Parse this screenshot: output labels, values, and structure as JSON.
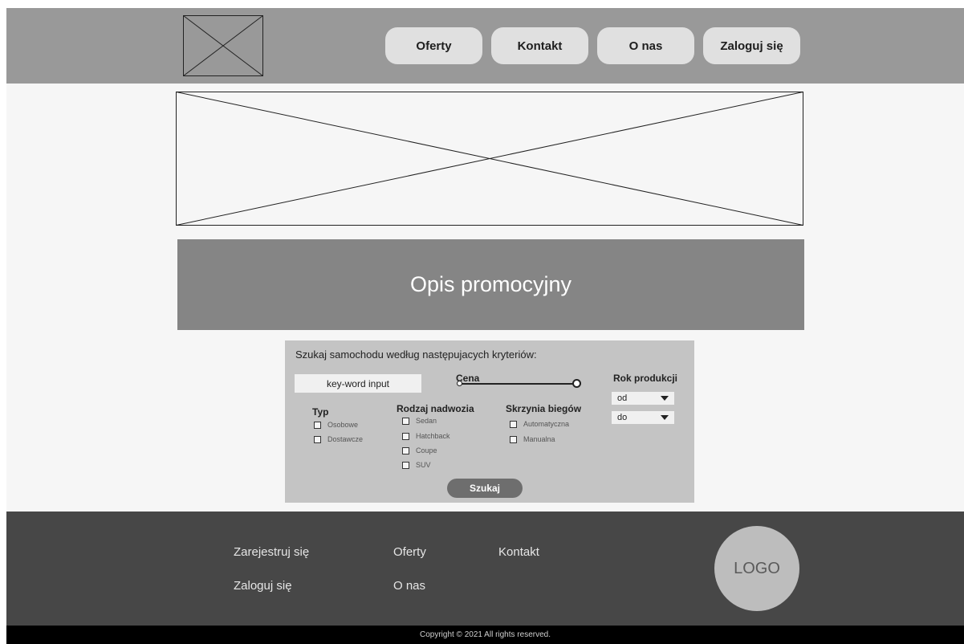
{
  "header": {
    "nav": [
      {
        "label": "Oferty"
      },
      {
        "label": "Kontakt"
      },
      {
        "label": "O nas"
      },
      {
        "label": "Zaloguj się"
      }
    ]
  },
  "promo": {
    "text": "Opis promocyjny"
  },
  "search": {
    "title": "Szukaj samochodu według następujacych kryteriów:",
    "keyword_placeholder": "key-word input",
    "price_label": "Cena",
    "price_range": {
      "min_fraction": 0.0,
      "max_fraction": 1.0
    },
    "typ": {
      "title": "Typ",
      "options": [
        "Osobowe",
        "Dostawcze"
      ]
    },
    "body": {
      "title": "Rodzaj nadwozia",
      "options": [
        "Sedan",
        "Hatchback",
        "Coupe",
        "SUV"
      ]
    },
    "gearbox": {
      "title": "Skrzynia biegów",
      "options": [
        "Automatyczna",
        "Manualna"
      ]
    },
    "year": {
      "title": "Rok produkcji",
      "from": "od",
      "to": "do"
    },
    "submit_label": "Szukaj"
  },
  "footer": {
    "links": [
      "Zarejestruj się",
      "Oferty",
      "Kontakt",
      "Zaloguj się",
      "O nas"
    ],
    "logo_text": "LOGO",
    "copyright": "Copyright © 2021 All rights reserved."
  },
  "colors": {
    "header_bg": "#999999",
    "promo_bg": "#858585",
    "search_bg": "#c4c4c4",
    "footer_bg": "#474747",
    "copyright_bg": "#000000"
  },
  "icons": {
    "logo_placeholder": "image-placeholder-icon",
    "hero_placeholder": "image-placeholder-icon",
    "select_arrow": "caret-down-icon"
  }
}
